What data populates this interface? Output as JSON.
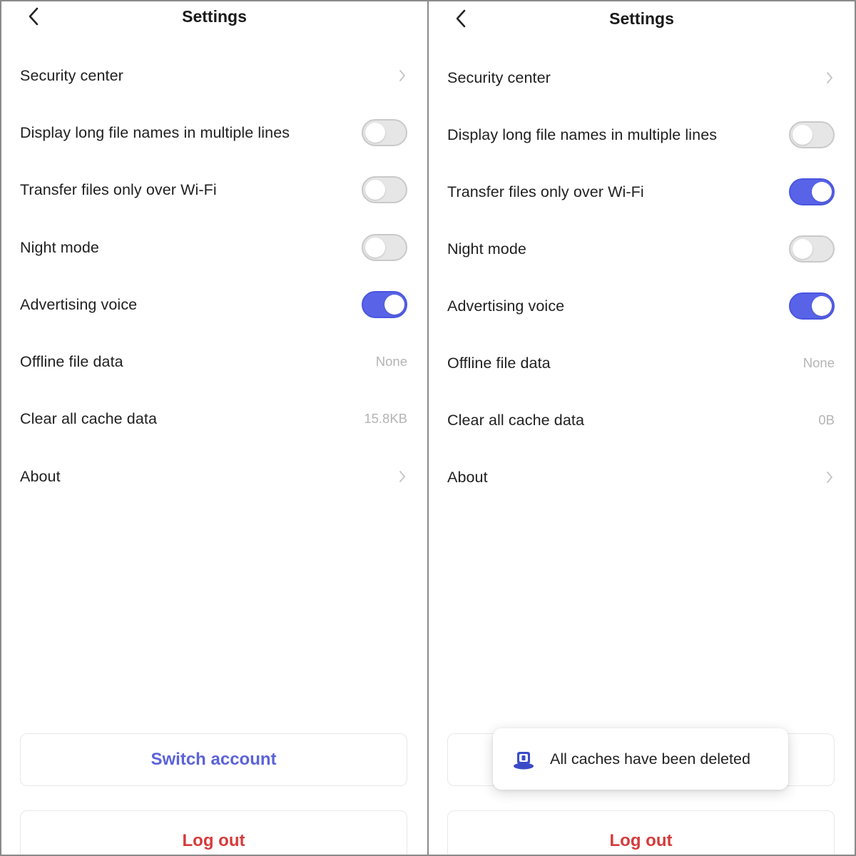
{
  "colors": {
    "accent": "#5863e8",
    "switch_account_text": "#5b63d8",
    "logout_text": "#d63b3b",
    "toggle_off": "#e6e6e6",
    "value_text": "#b4b4b4"
  },
  "screens": [
    {
      "header": {
        "title": "Settings",
        "back_icon": "chevron-left-icon"
      },
      "rows": {
        "security_center": {
          "label": "Security center",
          "icon": "chevron-right-icon"
        },
        "long_names": {
          "label": "Display long file names in multiple lines",
          "on": false
        },
        "wifi_only": {
          "label": "Transfer files only over Wi-Fi",
          "on": false
        },
        "night_mode": {
          "label": "Night mode",
          "on": false
        },
        "advertising_voice": {
          "label": "Advertising voice",
          "on": true
        },
        "offline_data": {
          "label": "Offline file data",
          "value": "None"
        },
        "clear_cache": {
          "label": "Clear all cache data",
          "value": "15.8KB"
        },
        "about": {
          "label": "About",
          "icon": "chevron-right-icon"
        }
      },
      "buttons": {
        "switch_account": "Switch account",
        "logout": "Log out"
      }
    },
    {
      "header": {
        "title": "Settings",
        "back_icon": "chevron-left-icon"
      },
      "rows": {
        "security_center": {
          "label": "Security center",
          "icon": "chevron-right-icon"
        },
        "long_names": {
          "label": "Display long file names in multiple lines",
          "on": false
        },
        "wifi_only": {
          "label": "Transfer files only over Wi-Fi",
          "on": true
        },
        "night_mode": {
          "label": "Night mode",
          "on": false
        },
        "advertising_voice": {
          "label": "Advertising voice",
          "on": true
        },
        "offline_data": {
          "label": "Offline file data",
          "value": "None"
        },
        "clear_cache": {
          "label": "Clear all cache data",
          "value": "0B"
        },
        "about": {
          "label": "About",
          "icon": "chevron-right-icon"
        }
      },
      "buttons": {
        "logout": "Log out"
      },
      "toast": {
        "message": "All caches have been deleted",
        "icon": "app-logo-icon"
      }
    }
  ]
}
